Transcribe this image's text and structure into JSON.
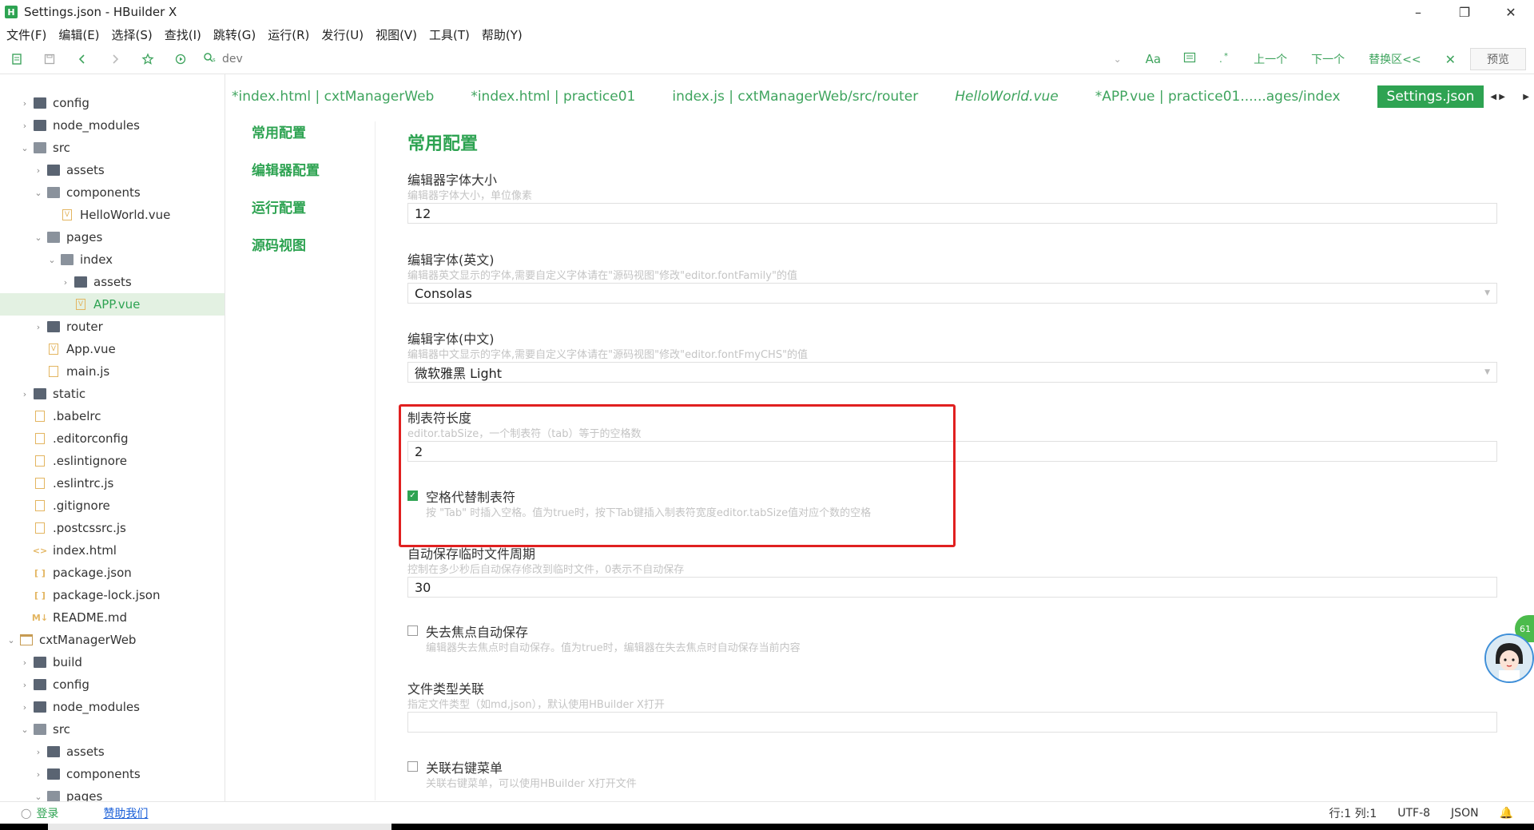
{
  "window": {
    "logo": "H",
    "title": "Settings.json - HBuilder X",
    "minimize": "–",
    "maximize": "❐",
    "close": "✕"
  },
  "menu": [
    {
      "label": "文件(F)"
    },
    {
      "label": "编辑(E)"
    },
    {
      "label": "选择(S)"
    },
    {
      "label": "查找(I)"
    },
    {
      "label": "跳转(G)"
    },
    {
      "label": "运行(R)"
    },
    {
      "label": "发行(U)"
    },
    {
      "label": "视图(V)"
    },
    {
      "label": "工具(T)"
    },
    {
      "label": "帮助(Y)"
    }
  ],
  "toolbar": {
    "search_placeholder": "dev",
    "aa": "Aa",
    "prev": "上一个",
    "next": "下一个",
    "replace": "替换区<<",
    "close": "✕",
    "preview": "预览"
  },
  "tree": [
    {
      "label": "config",
      "depth": 1,
      "type": "folder",
      "toggle": "›"
    },
    {
      "label": "node_modules",
      "depth": 1,
      "type": "folder",
      "toggle": "›"
    },
    {
      "label": "src",
      "depth": 1,
      "type": "folder-open",
      "toggle": "⌄"
    },
    {
      "label": "assets",
      "depth": 2,
      "type": "folder",
      "toggle": "›"
    },
    {
      "label": "components",
      "depth": 2,
      "type": "folder-open",
      "toggle": "⌄"
    },
    {
      "label": "HelloWorld.vue",
      "depth": 3,
      "type": "vue",
      "toggle": ""
    },
    {
      "label": "pages",
      "depth": 2,
      "type": "folder-open",
      "toggle": "⌄"
    },
    {
      "label": "index",
      "depth": 3,
      "type": "folder-open",
      "toggle": "⌄"
    },
    {
      "label": "assets",
      "depth": 4,
      "type": "folder",
      "toggle": "›"
    },
    {
      "label": "APP.vue",
      "depth": 4,
      "type": "vue",
      "toggle": "",
      "selected": true
    },
    {
      "label": "router",
      "depth": 2,
      "type": "folder",
      "toggle": "›"
    },
    {
      "label": "App.vue",
      "depth": 2,
      "type": "vue",
      "toggle": ""
    },
    {
      "label": "main.js",
      "depth": 2,
      "type": "file",
      "toggle": ""
    },
    {
      "label": "static",
      "depth": 1,
      "type": "folder",
      "toggle": "›"
    },
    {
      "label": ".babelrc",
      "depth": 1,
      "type": "file",
      "toggle": ""
    },
    {
      "label": ".editorconfig",
      "depth": 1,
      "type": "file",
      "toggle": ""
    },
    {
      "label": ".eslintignore",
      "depth": 1,
      "type": "file",
      "toggle": ""
    },
    {
      "label": ".eslintrc.js",
      "depth": 1,
      "type": "file",
      "toggle": ""
    },
    {
      "label": ".gitignore",
      "depth": 1,
      "type": "file",
      "toggle": ""
    },
    {
      "label": ".postcssrc.js",
      "depth": 1,
      "type": "file",
      "toggle": ""
    },
    {
      "label": "index.html",
      "depth": 1,
      "type": "code",
      "toggle": ""
    },
    {
      "label": "package.json",
      "depth": 1,
      "type": "json",
      "toggle": ""
    },
    {
      "label": "package-lock.json",
      "depth": 1,
      "type": "json",
      "toggle": ""
    },
    {
      "label": "README.md",
      "depth": 1,
      "type": "md",
      "toggle": ""
    },
    {
      "label": "cxtManagerWeb",
      "depth": 0,
      "type": "proj",
      "toggle": "⌄"
    },
    {
      "label": "build",
      "depth": 1,
      "type": "folder",
      "toggle": "›"
    },
    {
      "label": "config",
      "depth": 1,
      "type": "folder",
      "toggle": "›"
    },
    {
      "label": "node_modules",
      "depth": 1,
      "type": "folder",
      "toggle": "›"
    },
    {
      "label": "src",
      "depth": 1,
      "type": "folder-open",
      "toggle": "⌄"
    },
    {
      "label": "assets",
      "depth": 2,
      "type": "folder",
      "toggle": "›"
    },
    {
      "label": "components",
      "depth": 2,
      "type": "folder",
      "toggle": "›"
    },
    {
      "label": "pages",
      "depth": 2,
      "type": "folder-open",
      "toggle": "⌄"
    }
  ],
  "tabs": [
    {
      "label": "*index.html | cxtManagerWeb",
      "italic": false,
      "active": false
    },
    {
      "label": "*index.html | practice01",
      "italic": false,
      "active": false
    },
    {
      "label": "index.js | cxtManagerWeb/src/router",
      "italic": false,
      "active": false
    },
    {
      "label": "HelloWorld.vue",
      "italic": true,
      "active": false
    },
    {
      "label": "*APP.vue | practice01......ages/index",
      "italic": false,
      "active": false
    },
    {
      "label": "Settings.json",
      "italic": false,
      "active": true
    }
  ],
  "tab_arrows": "◀ ▶",
  "settings_nav": [
    {
      "label": "常用配置"
    },
    {
      "label": "编辑器配置"
    },
    {
      "label": "运行配置"
    },
    {
      "label": "源码视图"
    }
  ],
  "content": {
    "title": "常用配置",
    "font_size": {
      "label": "编辑器字体大小",
      "desc": "编辑器字体大小，单位像素",
      "value": "12"
    },
    "font_en": {
      "label": "编辑字体(英文)",
      "desc": "编辑器英文显示的字体,需要自定义字体请在\"源码视图\"修改\"editor.fontFamily\"的值",
      "value": "Consolas"
    },
    "font_cn": {
      "label": "编辑字体(中文)",
      "desc": "编辑器中文显示的字体,需要自定义字体请在\"源码视图\"修改\"editor.fontFmyCHS\"的值",
      "value": "微软雅黑 Light"
    },
    "tab_size": {
      "label": "制表符长度",
      "desc": "editor.tabSize，一个制表符（tab）等于的空格数",
      "value": "2"
    },
    "insert_spaces": {
      "label": "空格代替制表符",
      "desc": "按 \"Tab\" 时插入空格。值为true时，按下Tab键插入制表符宽度editor.tabSize值对应个数的空格",
      "checked": true,
      "check": "✓"
    },
    "autosave": {
      "label": "自动保存临时文件周期",
      "desc": "控制在多少秒后自动保存修改到临时文件，0表示不自动保存",
      "value": "30"
    },
    "blur_save": {
      "label": "失去焦点自动保存",
      "desc": "编辑器失去焦点时自动保存。值为true时，编辑器在失去焦点时自动保存当前内容",
      "checked": false
    },
    "file_assoc": {
      "label": "文件类型关联",
      "desc": "指定文件类型（如md,json），默认使用HBuilder X打开",
      "value": ""
    },
    "context_menu": {
      "label": "关联右键菜单",
      "desc": "关联右键菜单，可以使用HBuilder X打开文件",
      "checked": false
    }
  },
  "badge": "61",
  "statusbar": {
    "login": "登录",
    "sponsor": "赞助我们",
    "position": "行:1  列:1",
    "encoding": "UTF-8",
    "language": "JSON",
    "bell": "🔔"
  },
  "colors": {
    "accent": "#2ea352",
    "highlight": "#e02020",
    "link": "#1a5fd8"
  }
}
